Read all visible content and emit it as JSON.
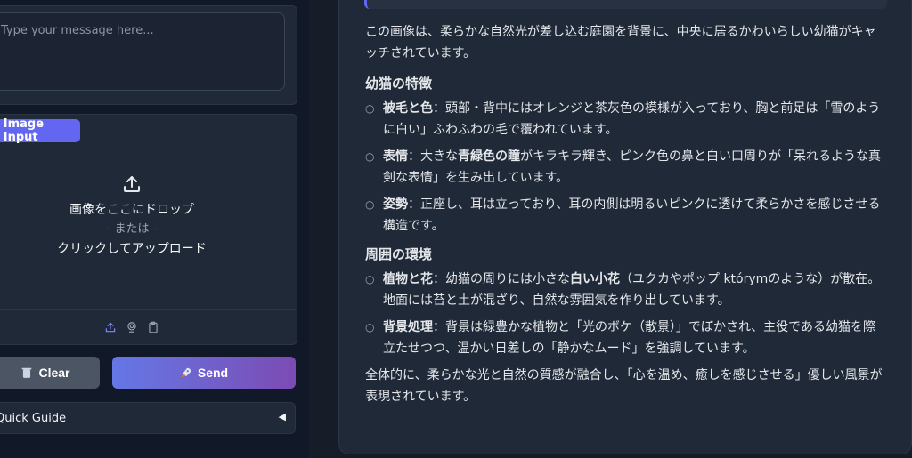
{
  "message": {
    "placeholder": "Type your message here..."
  },
  "image_input": {
    "badge": "Image Input",
    "drop_line": "画像をここにドロップ",
    "or_line": "- または -",
    "click_line": "クリックしてアップロード"
  },
  "buttons": {
    "clear": "Clear",
    "send": "Send"
  },
  "guide": {
    "label": "Quick Guide",
    "arrow": "◀"
  },
  "response": {
    "intro": "この画像は、柔らかな自然光が差し込む庭園を背景に、中央に居るかわいらしい幼猫がキャッチされています。",
    "sec1": "幼猫の特徴",
    "b1_term": "被毛と色",
    "b1_text": "：頭部・背中にはオレンジと茶灰色の模様が入っており、胸と前足は「雪のように白い」ふわふわの毛で覆われています。",
    "b2_term": "表情",
    "b2_pre": "：大きな",
    "b2_bold": "青緑色の瞳",
    "b2_post": "がキラキラ輝き、ピンク色の鼻と白い口周りが「呆れるような真剣な表情」を生み出しています。",
    "b3_term": "姿勢",
    "b3_text": "：正座し、耳は立っており、耳の内側は明るいピンクに透けて柔らかさを感じさせる構造です。",
    "sec2": "周囲の環境",
    "b4_term": "植物と花",
    "b4_pre": "：幼猫の周りには小さな",
    "b4_bold": "白い小花",
    "b4_post": "（ユクカやポップ którymのような）が散在。地面には苔と土が混ざり、自然な雰囲気を作り出しています。",
    "b5_term": "背景処理",
    "b5_text": "：背景は緑豊かな植物と「光のボケ（散景）」でぼかされ、主役である幼猫を際立たせつつ、温かい日差しの「静かなムード」を強調しています。",
    "outro": "全体的に、柔らかな光と自然の質感が融合し、「心を温め、癒しを感じさせる」優しい風景が表現されています。",
    "bullet": "○"
  },
  "icons": [
    "upload-icon",
    "webcam-icon",
    "clipboard-icon",
    "trash-icon",
    "rocket-icon",
    "image-icon"
  ],
  "colors": {
    "accent": "#6366f1",
    "send_start": "#6478e6",
    "send_end": "#7c4bb3",
    "clear": "#4b5563"
  }
}
